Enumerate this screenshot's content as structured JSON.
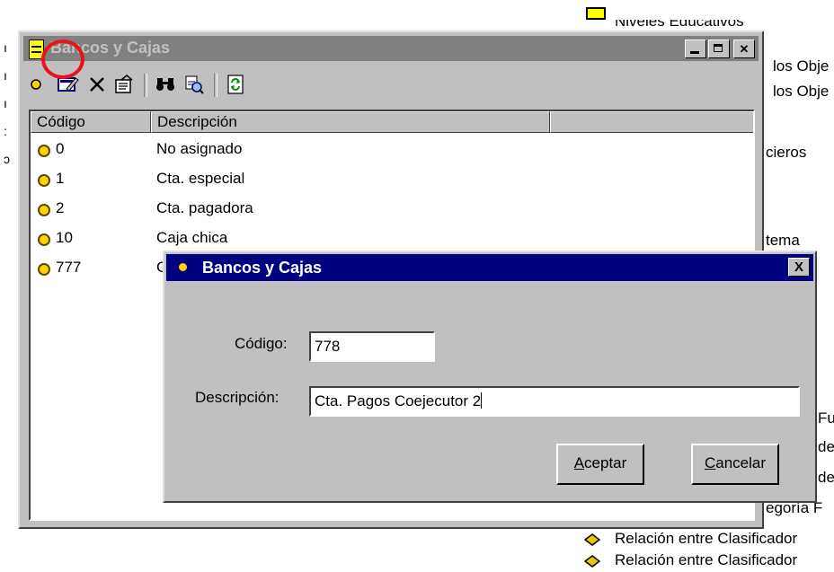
{
  "background": {
    "right_items": [
      {
        "text": "Niveles Educativos"
      },
      {
        "text": "los Obje"
      },
      {
        "text": "los Obje"
      },
      {
        "text": "cieros"
      },
      {
        "text": "tema"
      },
      {
        "text": "Fu"
      },
      {
        "text": "de"
      },
      {
        "text": "de"
      },
      {
        "text": "egoría F"
      },
      {
        "text": "Relación entre Clasificador"
      },
      {
        "text": "Relación entre Clasificador"
      }
    ]
  },
  "main_window": {
    "title": "Bancos y Cajas",
    "columns": [
      "Código",
      "Descripción",
      ""
    ],
    "rows": [
      {
        "code": "0",
        "description": "No asignado"
      },
      {
        "code": "1",
        "description": "Cta. especial"
      },
      {
        "code": "2",
        "description": "Cta. pagadora"
      },
      {
        "code": "10",
        "description": "Caja chica"
      },
      {
        "code": "777",
        "description": "C"
      }
    ]
  },
  "dialog": {
    "title": "Bancos y Cajas",
    "close_label": "X",
    "code_label": "Código:",
    "code_value": "778",
    "description_label": "Descripción:",
    "description_value": "Cta. Pagos Coejecutor 2",
    "accept_label": "Aceptar",
    "accept_mnemonic": "A",
    "accept_rest": "ceptar",
    "cancel_label": "Cancelar",
    "cancel_mnemonic": "C",
    "cancel_rest": "ancelar"
  },
  "colors": {
    "dialog_titlebar": "#000080",
    "inactive_titlebar": "#808080",
    "highlight_circle": "#e8141c",
    "bullet": "#ffd200"
  }
}
